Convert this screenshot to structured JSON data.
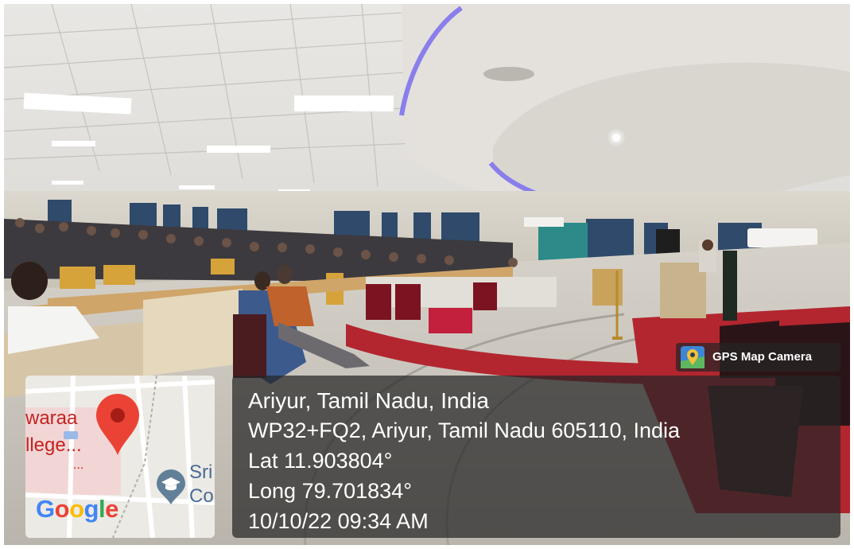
{
  "badge": {
    "label": "GPS Map Camera",
    "icon": "camera-map-pin-icon"
  },
  "map": {
    "labels": {
      "college_top": "waraa",
      "college_bottom": "llege...",
      "dots": "...",
      "nearby_top": "Sri",
      "nearby_bottom": "Co"
    },
    "brand": "Google",
    "pin_color": "#ea4335"
  },
  "location": {
    "title": "Ariyur, Tamil Nadu, India",
    "address": "WP32+FQ2, Ariyur, Tamil Nadu 605110, India",
    "lat": "Lat 11.903804°",
    "long": "Long 79.701834°",
    "datetime": "10/10/22 09:34 AM"
  },
  "colors": {
    "overlay": "#262626",
    "carpet": "#b3262f",
    "ceiling_light": "#7a6cf0"
  }
}
